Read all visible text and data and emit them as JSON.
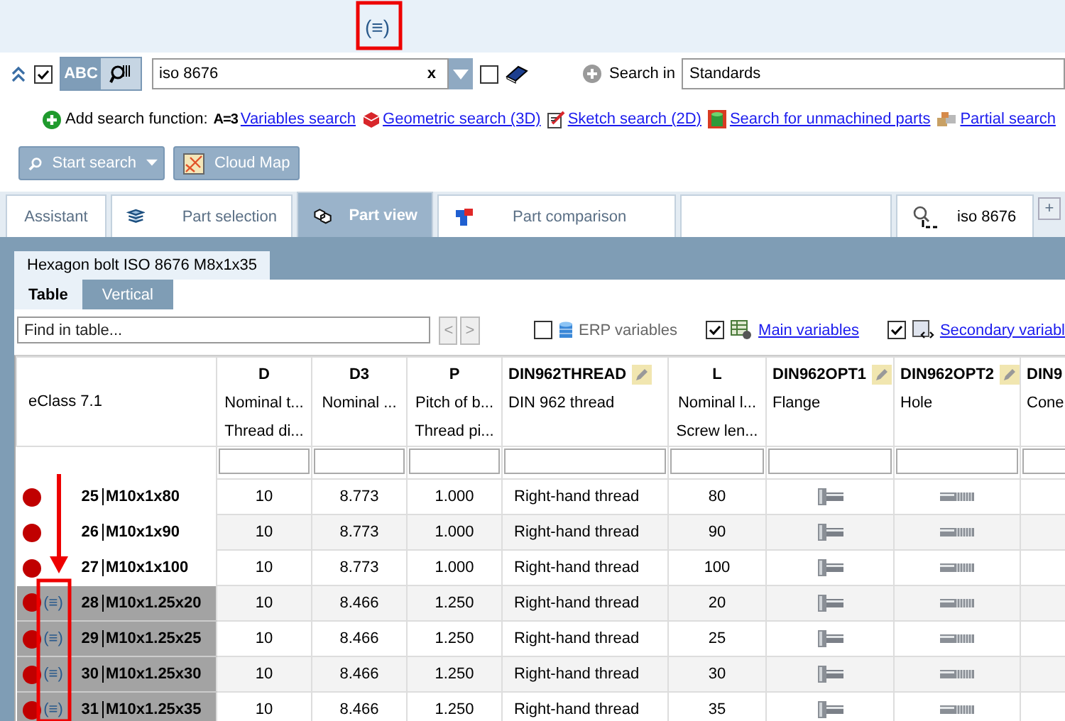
{
  "top_marker": "(≡)",
  "search_bar": {
    "scope_checked": true,
    "modes": [
      {
        "label": "ABC",
        "selected": true
      },
      {
        "kind": "barcode",
        "selected": false
      }
    ],
    "query": "iso 8676",
    "clear": "x",
    "catalog_checked": false,
    "search_in_label": "Search in",
    "search_in_value": "Standards"
  },
  "add_search": {
    "label": "Add search function:",
    "functions": [
      {
        "icon": "A=3",
        "label": "Variables search"
      },
      {
        "label": "Geometric search (3D)"
      },
      {
        "label": "Sketch search (2D)"
      },
      {
        "label": "Search for unmachined parts"
      },
      {
        "label": "Partial search"
      }
    ]
  },
  "buttons": [
    {
      "label": "Start search"
    },
    {
      "label": "Cloud Map"
    }
  ],
  "tabs": [
    {
      "label": "Assistant",
      "selected": false
    },
    {
      "label": "Part selection",
      "selected": false
    },
    {
      "label": "Part view",
      "selected": true
    },
    {
      "label": "Part comparison",
      "selected": false
    },
    {
      "selected": false
    },
    {
      "label": "iso 8676",
      "selected": false
    }
  ],
  "add_tab": "+",
  "part_tab": "Hexagon bolt ISO 8676 M8x1x35",
  "view_tabs": [
    {
      "label": "Table",
      "selected": true
    },
    {
      "label": "Vertical",
      "selected": false
    }
  ],
  "find": {
    "placeholder": "Find in table...",
    "prev": "<",
    "next": ">",
    "options": [
      {
        "label": "ERP variables",
        "checked": false,
        "link": false
      },
      {
        "label": "Main variables",
        "checked": true,
        "link": true
      },
      {
        "label": "Secondary variabl",
        "checked": true,
        "link": true
      }
    ]
  },
  "table": {
    "row_header": "eClass 7.1",
    "columns": [
      {
        "name": "D",
        "line2": "Nominal t...",
        "line3": "Thread di...",
        "kind": "text",
        "editable": false
      },
      {
        "name": "D3",
        "line2": "Nominal ...",
        "kind": "text",
        "editable": false
      },
      {
        "name": "P",
        "line2": "Pitch of b...",
        "line3": "Thread pi...",
        "kind": "text",
        "editable": false
      },
      {
        "name": "DIN962THREAD",
        "line2": "DIN 962 thread",
        "kind": "text",
        "editable": true
      },
      {
        "name": "L",
        "line2": "Nominal l...",
        "line3": "Screw len...",
        "kind": "text",
        "editable": false
      },
      {
        "name": "DIN962OPT1",
        "line2": "Flange",
        "kind": "flange",
        "editable": true
      },
      {
        "name": "DIN962OPT2",
        "line2": "Hole",
        "kind": "hole",
        "editable": true
      },
      {
        "name": "DIN9",
        "line2": "Cone",
        "kind": "empty"
      }
    ],
    "rows": [
      {
        "number": "25",
        "name": "M10x1x80",
        "selected": false,
        "values": [
          "10",
          "8.773",
          "1.000",
          "Right-hand thread",
          "80"
        ]
      },
      {
        "number": "26",
        "name": "M10x1x90",
        "selected": false,
        "values": [
          "10",
          "8.773",
          "1.000",
          "Right-hand thread",
          "90"
        ]
      },
      {
        "number": "27",
        "name": "M10x1x100",
        "selected": false,
        "values": [
          "10",
          "8.773",
          "1.000",
          "Right-hand thread",
          "100"
        ]
      },
      {
        "number": "28",
        "name": "M10x1.25x20",
        "selected": true,
        "marker": "(≡)",
        "values": [
          "10",
          "8.466",
          "1.250",
          "Right-hand thread",
          "20"
        ]
      },
      {
        "number": "29",
        "name": "M10x1.25x25",
        "selected": true,
        "marker": "(≡)",
        "values": [
          "10",
          "8.466",
          "1.250",
          "Right-hand thread",
          "25"
        ]
      },
      {
        "number": "30",
        "name": "M10x1.25x30",
        "selected": true,
        "marker": "(≡)",
        "values": [
          "10",
          "8.466",
          "1.250",
          "Right-hand thread",
          "30"
        ]
      },
      {
        "number": "31",
        "name": "M10x1.25x35",
        "selected": true,
        "marker": "(≡)",
        "values": [
          "10",
          "8.466",
          "1.250",
          "Right-hand thread",
          "35"
        ]
      }
    ]
  }
}
